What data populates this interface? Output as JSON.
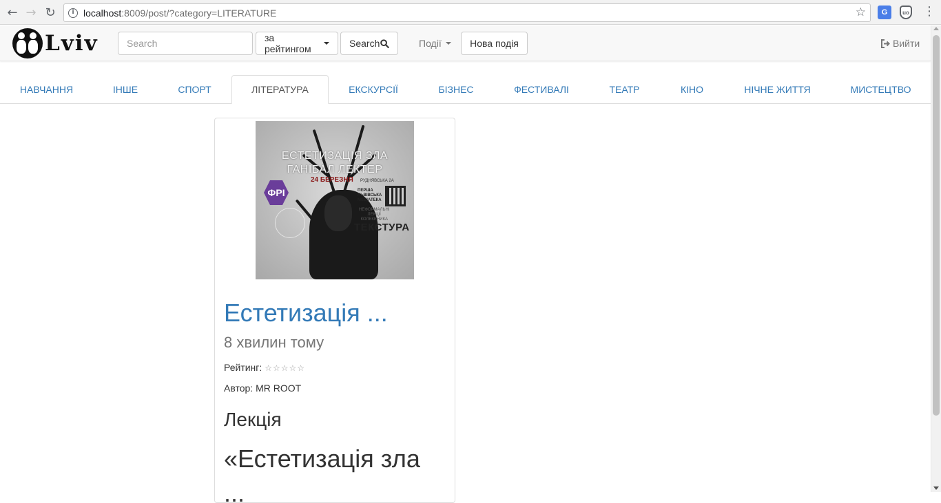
{
  "browser": {
    "back_icon": "arrow-left-icon",
    "forward_icon": "arrow-right-icon",
    "reload_icon": "reload-icon",
    "url_host": "localhost",
    "url_rest": ":8009/post/?category=LITERATURE",
    "bookmark_icon": "star-icon",
    "translate_label": "G",
    "ublock_label": "uo"
  },
  "navbar": {
    "logo_text": "Lviv",
    "search_placeholder": "Search",
    "sort_label": "за рейтингом",
    "search_button_label": "Search",
    "events_label": "Події",
    "new_event_label": "Нова подія",
    "logout_label": "Вийти"
  },
  "tabs": [
    {
      "label": "НАВЧАННЯ",
      "active": false
    },
    {
      "label": "ІНШЕ",
      "active": false
    },
    {
      "label": "СПОРТ",
      "active": false
    },
    {
      "label": "ЛІТЕРАТУРА",
      "active": true
    },
    {
      "label": "ЕКСКУРСІЇ",
      "active": false
    },
    {
      "label": "БІЗНЕС",
      "active": false
    },
    {
      "label": "ФЕСТИВАЛІ",
      "active": false
    },
    {
      "label": "ТЕАТР",
      "active": false
    },
    {
      "label": "КІНО",
      "active": false
    },
    {
      "label": "НІЧНЕ ЖИТТЯ",
      "active": false
    },
    {
      "label": "МИСТЕЦТВО",
      "active": false
    }
  ],
  "post": {
    "poster": {
      "title_line1": "ЕСТЕТИЗАЦІЯ ЗЛА",
      "title_line2": "ГАНІБАЛ ЛЕКТЕР",
      "date": "24 БЕРЕЗНЯ",
      "badge": "ФРІ",
      "address": "РУДНЯВСЬКА 2А",
      "library_line1": "ПЕРША",
      "library_line2": "ЛЬВІВСЬКА",
      "library_line3": "МЕДІАТЕКА",
      "lecture_line1": "НЕФОРМАЛЬНІ",
      "lecture_line2": "ЛЕКЦІЇ",
      "lecture_line3": "КОЛЕКЕНИКА",
      "brand": "ТЕКСТУРА"
    },
    "title": "Естетизація ...",
    "time_ago": "8 хвилин тому",
    "rating_label": "Рейтинг:",
    "rating_stars": "☆☆☆☆☆",
    "rating_value": 0,
    "rating_max": 5,
    "author_label": "Автор:",
    "author_name": "MR ROOT",
    "body_heading": "Лекція",
    "body_title": "«Естетизація зла",
    "body_cut": "..."
  }
}
